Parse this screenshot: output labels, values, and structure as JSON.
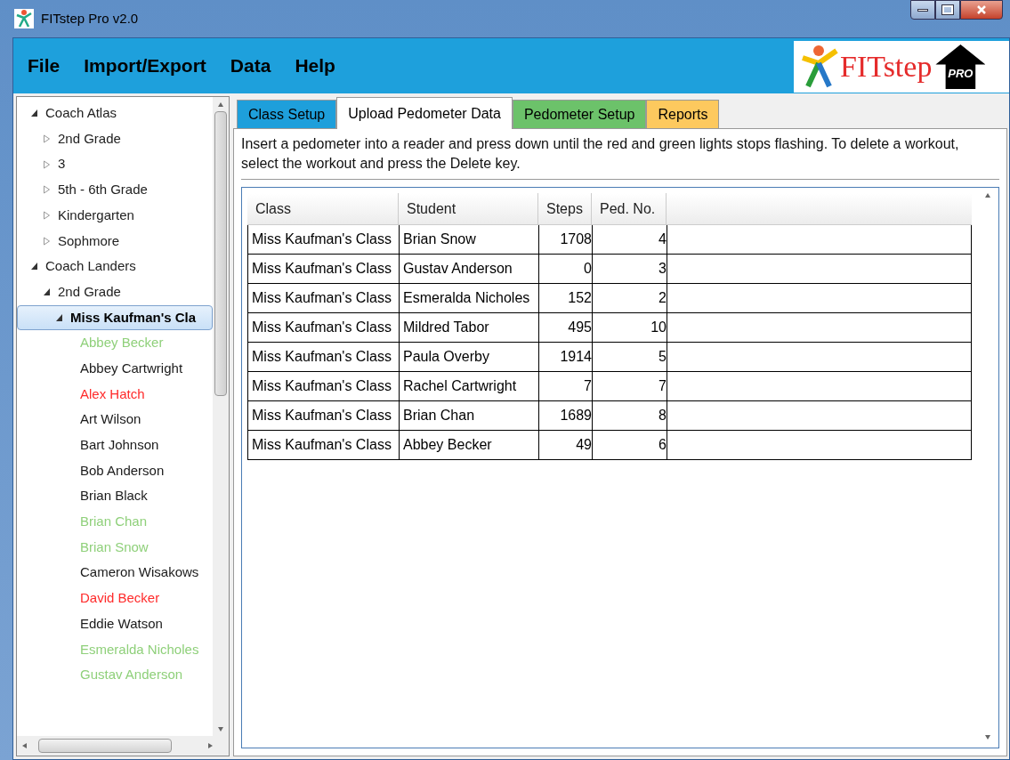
{
  "window": {
    "title": "FITstep Pro v2.0"
  },
  "menu": [
    "File",
    "Import/Export",
    "Data",
    "Help"
  ],
  "logo": {
    "name": "FITstep",
    "badge": "PRO"
  },
  "tree": [
    {
      "label": "Coach Atlas",
      "expanded": true,
      "selected": false,
      "children": [
        {
          "label": "2nd Grade",
          "expanded": false,
          "selected": false
        },
        {
          "label": "3",
          "expanded": false,
          "selected": false
        },
        {
          "label": "5th - 6th Grade",
          "expanded": false,
          "selected": false
        },
        {
          "label": "Kindergarten",
          "expanded": false,
          "selected": false
        },
        {
          "label": "Sophmore",
          "expanded": false,
          "selected": false
        }
      ]
    },
    {
      "label": "Coach Landers",
      "expanded": true,
      "selected": false,
      "children": [
        {
          "label": "2nd Grade",
          "expanded": true,
          "selected": false,
          "children": [
            {
              "label": "Miss Kaufman's Cla",
              "expanded": true,
              "selected": true,
              "children": [
                {
                  "label": "Abbey Becker",
                  "selected": false,
                  "color": "#8fd07a"
                },
                {
                  "label": "Abbey Cartwright",
                  "selected": false,
                  "color": "#1a1a1a"
                },
                {
                  "label": "Alex Hatch",
                  "selected": false,
                  "color": "#ff2a2a"
                },
                {
                  "label": "Art Wilson",
                  "selected": false,
                  "color": "#1a1a1a"
                },
                {
                  "label": "Bart Johnson",
                  "selected": false,
                  "color": "#1a1a1a"
                },
                {
                  "label": "Bob Anderson",
                  "selected": false,
                  "color": "#1a1a1a"
                },
                {
                  "label": "Brian Black",
                  "selected": false,
                  "color": "#1a1a1a"
                },
                {
                  "label": "Brian Chan",
                  "selected": false,
                  "color": "#8fd07a"
                },
                {
                  "label": "Brian Snow",
                  "selected": false,
                  "color": "#8fd07a"
                },
                {
                  "label": "Cameron Wisakows",
                  "selected": false,
                  "color": "#1a1a1a"
                },
                {
                  "label": "David Becker",
                  "selected": false,
                  "color": "#ff2a2a"
                },
                {
                  "label": "Eddie Watson",
                  "selected": false,
                  "color": "#1a1a1a"
                },
                {
                  "label": "Esmeralda Nicholes",
                  "selected": false,
                  "color": "#8fd07a"
                },
                {
                  "label": "Gustav Anderson",
                  "selected": false,
                  "color": "#8fd07a"
                }
              ]
            }
          ]
        }
      ]
    }
  ],
  "tabs": [
    {
      "label": "Class Setup",
      "selected": false,
      "color": "#1e9fdb"
    },
    {
      "label": "Upload Pedometer Data",
      "selected": true,
      "color": "#ffffff"
    },
    {
      "label": "Pedometer Setup",
      "selected": false,
      "color": "#6cc26a"
    },
    {
      "label": "Reports",
      "selected": false,
      "color": "#fdc95e"
    }
  ],
  "instructions": "Insert a pedometer into a reader and press down until the red and green lights stops flashing. To delete a workout, select the workout and press the Delete key.",
  "table": {
    "columns": [
      "Class",
      "Student",
      "Steps",
      "Ped. No."
    ],
    "rows": [
      [
        "Miss Kaufman's Class",
        "Brian Snow",
        "1708",
        "4"
      ],
      [
        "Miss Kaufman's Class",
        "Gustav Anderson",
        "0",
        "3"
      ],
      [
        "Miss Kaufman's Class",
        "Esmeralda Nicholes",
        "152",
        "2"
      ],
      [
        "Miss Kaufman's Class",
        "Mildred Tabor",
        "495",
        "10"
      ],
      [
        "Miss Kaufman's Class",
        "Paula Overby",
        "1914",
        "5"
      ],
      [
        "Miss Kaufman's Class",
        "Rachel Cartwright",
        "7",
        "7"
      ],
      [
        "Miss Kaufman's Class",
        "Brian Chan",
        "1689",
        "8"
      ],
      [
        "Miss Kaufman's Class",
        "Abbey Becker",
        "49",
        "6"
      ]
    ]
  }
}
